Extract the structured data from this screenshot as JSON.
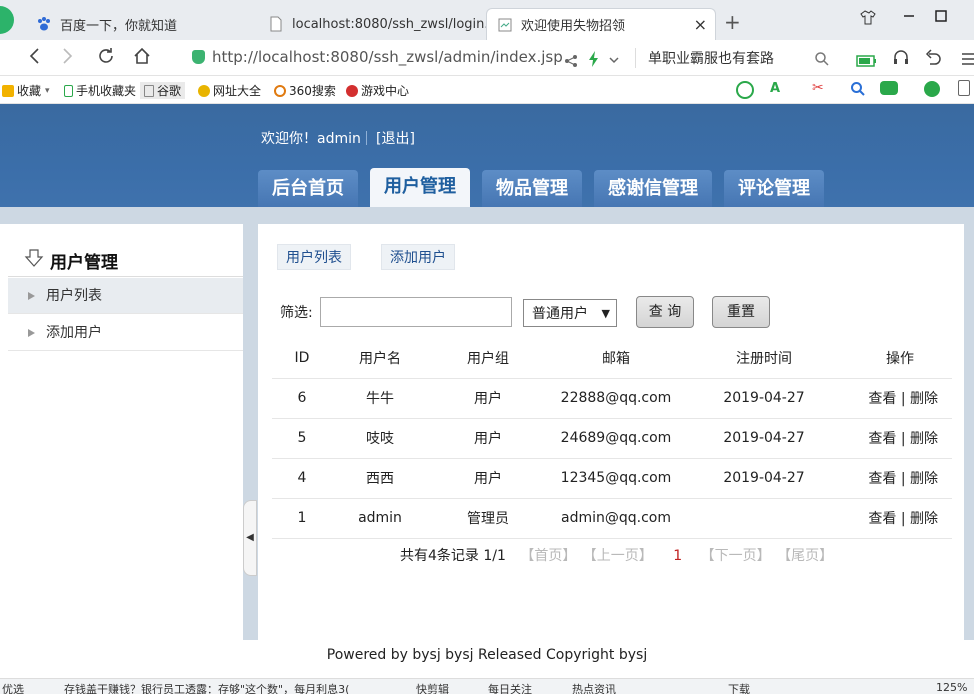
{
  "browser": {
    "tabs": [
      {
        "label": "百度一下，你就知道"
      },
      {
        "label": "localhost:8080/ssh_zwsl/login."
      },
      {
        "label": "欢迎使用失物招领"
      }
    ],
    "tab_close": "×",
    "new_tab": "+",
    "url": "http://localhost:8080/ssh_zwsl/admin/index.jsp",
    "search_text": "单职业霸服也有套路",
    "bookmarks": [
      {
        "label": "收藏"
      },
      {
        "label": "手机收藏夹"
      },
      {
        "label": "谷歌"
      },
      {
        "label": "网址大全"
      },
      {
        "label": "360搜索"
      },
      {
        "label": "游戏中心"
      }
    ]
  },
  "header": {
    "welcome": "欢迎你！admin",
    "logout": "[退出]",
    "nav": [
      {
        "label": "后台首页"
      },
      {
        "label": "用户管理"
      },
      {
        "label": "物品管理"
      },
      {
        "label": "感谢信管理"
      },
      {
        "label": "评论管理"
      }
    ]
  },
  "sidebar": {
    "title": "用户管理",
    "items": [
      {
        "label": "用户列表"
      },
      {
        "label": "添加用户"
      }
    ]
  },
  "main": {
    "subtabs": [
      {
        "label": "用户列表"
      },
      {
        "label": "添加用户"
      }
    ],
    "filter_label": "筛选:",
    "filter_value": "",
    "select_value": "普通用户",
    "query_btn": "查 询",
    "reset_btn": "重置",
    "columns": [
      "ID",
      "用户名",
      "用户组",
      "邮箱",
      "注册时间",
      "操作"
    ],
    "rows": [
      {
        "id": "6",
        "name": "牛牛",
        "group": "用户",
        "email": "22888@qq.com",
        "date": "2019-04-27",
        "view": "查看",
        "sep": "|",
        "del": "删除"
      },
      {
        "id": "5",
        "name": "吱吱",
        "group": "用户",
        "email": "24689@qq.com",
        "date": "2019-04-27",
        "view": "查看",
        "sep": "|",
        "del": "删除"
      },
      {
        "id": "4",
        "name": "西西",
        "group": "用户",
        "email": "12345@qq.com",
        "date": "2019-04-27",
        "view": "查看",
        "sep": "|",
        "del": "删除"
      },
      {
        "id": "1",
        "name": "admin",
        "group": "管理员",
        "email": "admin@qq.com",
        "date": "",
        "view": "查看",
        "sep": "|",
        "del": "删除"
      }
    ],
    "pager": {
      "summary": "共有4条记录 1/1",
      "first": "【首页】",
      "prev": "【上一页】",
      "current": "1",
      "next": "【下一页】",
      "last": "【尾页】"
    }
  },
  "footer": "Powered by bysj bysj Released  Copyright bysj",
  "statusbar": {
    "left": "优选",
    "news": "存钱盖干赚钱？银行员工透露：存够\"这个数\"，每月利息3(",
    "items": [
      "快剪辑",
      "每日关注",
      "热点资讯",
      "下载",
      "125%"
    ]
  }
}
